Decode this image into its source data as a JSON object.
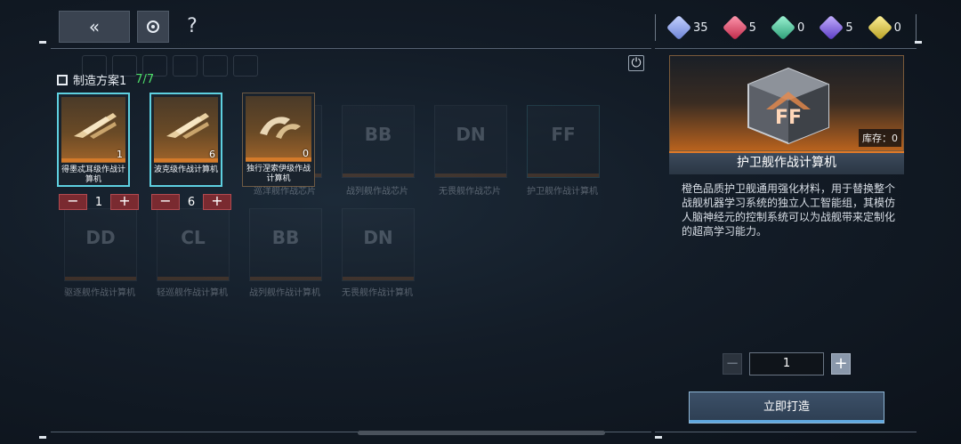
{
  "toolbar": {
    "back_icon": "double-chevron-left-icon",
    "refresh_icon": "refresh-icon",
    "help_label": "?"
  },
  "currencies": [
    {
      "icon": "blue-crystal-icon",
      "color": "#8fa6e6",
      "value": "35"
    },
    {
      "icon": "red-crystal-icon",
      "color": "#e04a6a",
      "value": "5"
    },
    {
      "icon": "green-crystal-icon",
      "color": "#4fd6a6",
      "value": "0"
    },
    {
      "icon": "purple-crystal-icon",
      "color": "#8a6ae6",
      "value": "5"
    },
    {
      "icon": "gold-crystal-icon",
      "color": "#e6d24a",
      "value": "0"
    }
  ],
  "plan": {
    "label": "制造方案1",
    "count": "7/7"
  },
  "items": [
    {
      "name": "得墨忒耳级作战计算机",
      "count": "1",
      "selected": true
    },
    {
      "name": "波克级作战计算机",
      "count": "6",
      "selected": true
    },
    {
      "name": "独行涅索伊级作战计算机",
      "count": "0",
      "selected": false
    }
  ],
  "steppers": [
    {
      "minus": "−",
      "value": "1",
      "plus": "+"
    },
    {
      "minus": "−",
      "value": "6",
      "plus": "+"
    }
  ],
  "ghost_items": [
    {
      "code": "",
      "label": "巡洋舰作战芯片"
    },
    {
      "code": "BB",
      "label": "战列舰作战芯片"
    },
    {
      "code": "DN",
      "label": "无畏舰作战芯片"
    },
    {
      "code": "FF",
      "label": "护卫舰作战计算机"
    },
    {
      "code": "DD",
      "label": "驱逐舰作战计算机"
    },
    {
      "code": "CL",
      "label": "轻巡舰作战计算机"
    },
    {
      "code": "BB",
      "label": "战列舰作战计算机"
    },
    {
      "code": "DN",
      "label": "无畏舰作战计算机"
    }
  ],
  "detail": {
    "badge": "FF",
    "stock": "库存：0",
    "title": "护卫舰作战计算机",
    "description": "橙色品质护卫舰通用强化材料，用于替换整个战舰机器学习系统的独立人工智能组，其模仿人脑神经元的控制系统可以为战舰带来定制化的超高学习能力。"
  },
  "quantity": {
    "minus": "−",
    "value": "1",
    "plus": "+"
  },
  "forge_button": "立即打造",
  "accent_color": "#e07a28"
}
